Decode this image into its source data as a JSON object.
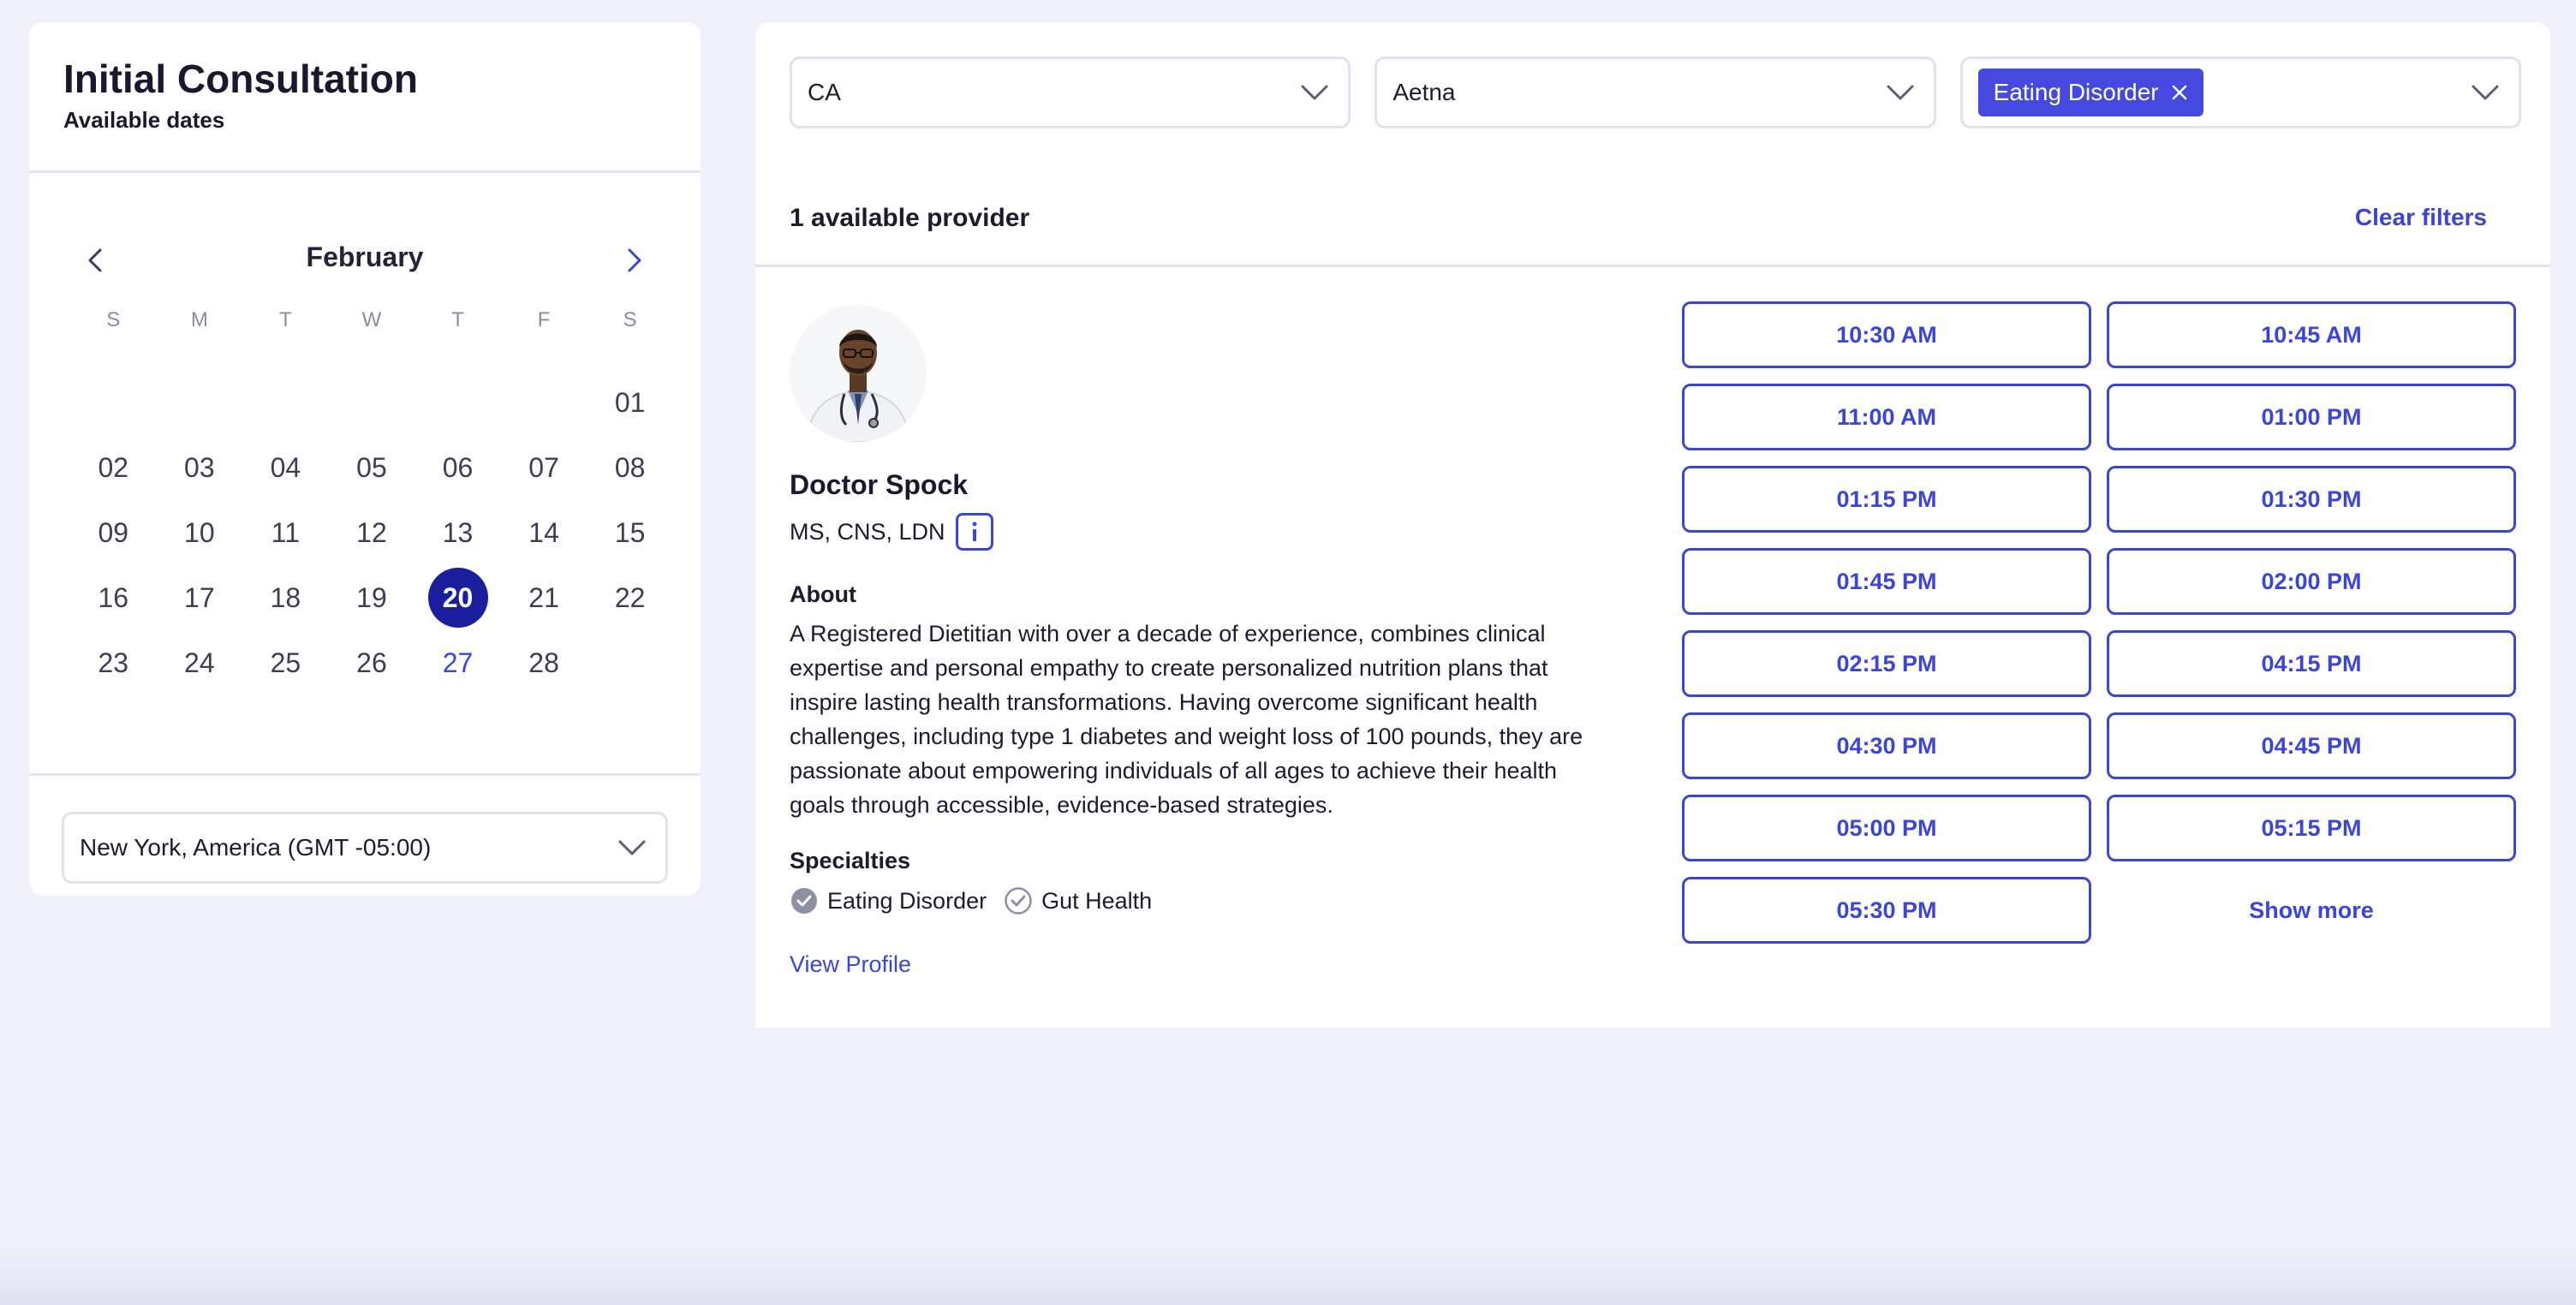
{
  "consultation": {
    "title": "Initial Consultation",
    "subtitle": "Available dates"
  },
  "calendar": {
    "month": "February",
    "weekdays": [
      "S",
      "M",
      "T",
      "W",
      "T",
      "F",
      "S"
    ],
    "weeks": [
      [
        "",
        "",
        "",
        "",
        "",
        "",
        "01"
      ],
      [
        "02",
        "03",
        "04",
        "05",
        "06",
        "07",
        "08"
      ],
      [
        "09",
        "10",
        "11",
        "12",
        "13",
        "14",
        "15"
      ],
      [
        "16",
        "17",
        "18",
        "19",
        "20",
        "21",
        "22"
      ],
      [
        "23",
        "24",
        "25",
        "26",
        "27",
        "28",
        ""
      ]
    ],
    "selected": "20",
    "highlighted": "27",
    "prev_icon": "chevron-left-icon",
    "next_icon": "chevron-right-icon"
  },
  "timezone": {
    "value": "New York, America (GMT -05:00)"
  },
  "filters": {
    "state": "CA",
    "insurance": "Aetna",
    "specialty_chip": "Eating Disorder"
  },
  "results": {
    "count_label": "1 available provider",
    "clear_label": "Clear filters"
  },
  "provider": {
    "name": "Doctor Spock",
    "credentials": "MS, CNS, LDN",
    "about_heading": "About",
    "about_text": "A Registered Dietitian with over a decade of experience, combines clinical expertise and personal empathy to create personalized nutrition plans that inspire lasting health transformations. Having overcome significant health challenges, including type 1 diabetes and weight loss of 100 pounds, they are passionate about empowering individuals of all ages to achieve their health goals through accessible, evidence-based strategies.",
    "specialties_heading": "Specialties",
    "specialties": [
      "Eating Disorder",
      "Gut Health"
    ],
    "view_profile": "View Profile"
  },
  "slots": [
    "10:30 AM",
    "10:45 AM",
    "11:00 AM",
    "01:00 PM",
    "01:15 PM",
    "01:30 PM",
    "01:45 PM",
    "02:00 PM",
    "02:15 PM",
    "04:15 PM",
    "04:30 PM",
    "04:45 PM",
    "05:00 PM",
    "05:15 PM",
    "05:30 PM"
  ],
  "show_more": "Show more",
  "colors": {
    "accent": "#3b45d8",
    "selected_day": "#1b1f9e",
    "chip": "#4549e0",
    "background": "#eef0fb"
  }
}
